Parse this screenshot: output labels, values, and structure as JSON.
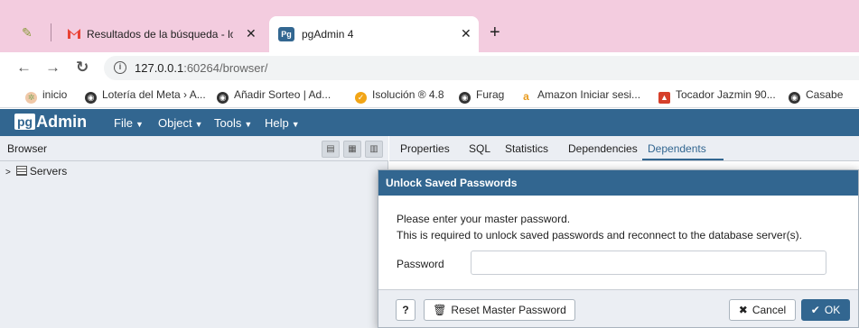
{
  "browser": {
    "tabs": [
      {
        "title": "Resultados de la búsqueda - lotería",
        "favicon": "gmail-icon"
      },
      {
        "title": "pgAdmin 4",
        "favicon": "pgadmin-icon",
        "favicon_text": "Pg",
        "active": true
      }
    ],
    "new_tab_label": "+",
    "close_glyph": "✕",
    "url_host": "127.0.0.1",
    "url_rest": ":60264/browser/",
    "info_glyph": "i",
    "bookmarks": [
      {
        "label": "inicio",
        "icon": "apps-icon"
      },
      {
        "label": "Lotería del Meta › A...",
        "icon": "globe-icon"
      },
      {
        "label": "Añadir Sorteo | Ad...",
        "icon": "globe-icon"
      },
      {
        "label": "Isolución ® 4.8",
        "icon": "isolucion-icon"
      },
      {
        "label": "Furag",
        "icon": "globe-icon"
      },
      {
        "label": "Amazon Iniciar sesi...",
        "icon": "amazon-icon"
      },
      {
        "label": "Tocador Jazmin 90...",
        "icon": "store-icon"
      },
      {
        "label": "Casabe",
        "icon": "globe-icon"
      }
    ]
  },
  "pgadmin": {
    "logo_pg": "pg",
    "logo_admin": "Admin",
    "menu": [
      "File",
      "Object",
      "Tools",
      "Help"
    ],
    "browser_panel": {
      "title": "Browser",
      "tree": [
        {
          "label": "Servers",
          "expanded": false
        }
      ]
    },
    "right_tabs": [
      "Properties",
      "SQL",
      "Statistics",
      "Dependencies",
      "Dependents"
    ],
    "active_tab": "Dependents"
  },
  "dialog": {
    "title": "Unlock Saved Passwords",
    "message_line1": "Please enter your master password.",
    "message_line2": "This is required to unlock saved passwords and reconnect to the database server(s).",
    "password_label": "Password",
    "password_value": "",
    "help_label": "?",
    "reset_label": "Reset Master Password",
    "cancel_label": "Cancel",
    "ok_label": "OK"
  },
  "colors": {
    "tabstrip": "#f3ccdf",
    "pgadmin_blue": "#326690",
    "panel_gray": "#ebeef3"
  }
}
